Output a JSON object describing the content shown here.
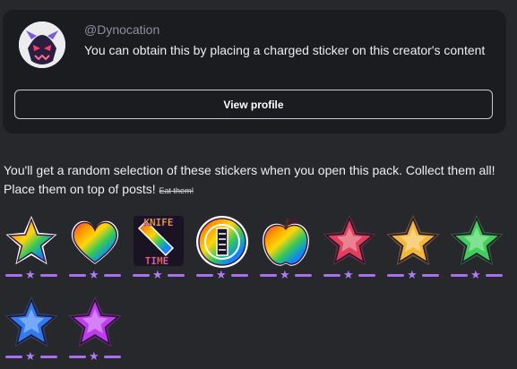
{
  "creator": {
    "handle": "@Dynocation",
    "description": "You can obtain this by placing a charged sticker on this creator's content",
    "view_profile_label": "View profile"
  },
  "intro": {
    "text": "You'll get a random selection of these stickers when you open this pack. Collect them all! Place them on top of posts!",
    "strike_text": "Eat them!"
  },
  "stickers": [
    {
      "name": "rainbow star",
      "icon": "rainbow-star-icon"
    },
    {
      "name": "rainbow heart",
      "icon": "rainbow-heart-icon"
    },
    {
      "name": "knife time",
      "icon": "knife-time-icon",
      "text_top": "KNIFE",
      "text_bottom": "TIME"
    },
    {
      "name": "rainbow coin",
      "icon": "rainbow-coin-icon"
    },
    {
      "name": "rainbow apple",
      "icon": "rainbow-apple-icon"
    },
    {
      "name": "red star",
      "icon": "red-star-icon",
      "color": "#e0405a"
    },
    {
      "name": "yellow star",
      "icon": "yellow-star-icon",
      "color": "#f2b83a"
    },
    {
      "name": "green star",
      "icon": "green-star-icon",
      "color": "#3fcf5a"
    },
    {
      "name": "blue star",
      "icon": "blue-star-icon",
      "color": "#2f7cf0"
    },
    {
      "name": "purple star",
      "icon": "purple-star-icon",
      "color": "#c03cf0"
    }
  ],
  "charge_star": "★",
  "colors": {
    "background": "#26282b",
    "card": "#1b1c1f",
    "charge_accent": "#a870f0"
  }
}
